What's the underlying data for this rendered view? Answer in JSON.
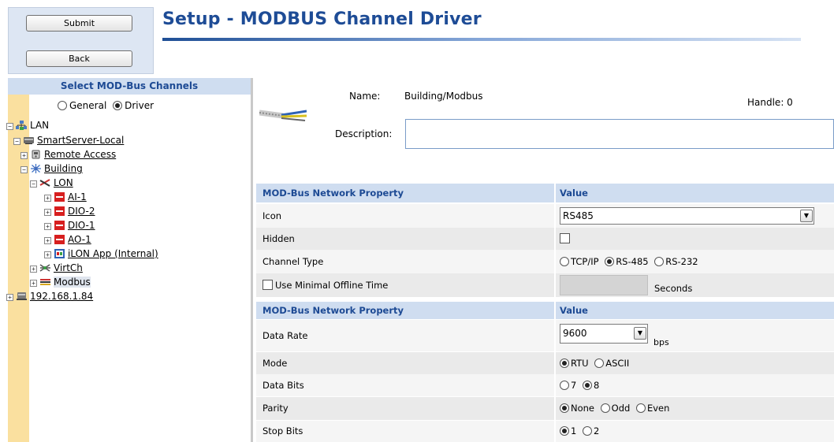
{
  "header": {
    "submit_label": "Submit",
    "back_label": "Back",
    "title": "Setup - MODBUS Channel Driver"
  },
  "tree": {
    "header": "Select MOD-Bus Channels",
    "view_options": [
      {
        "label": "General",
        "selected": false
      },
      {
        "label": "Driver",
        "selected": true
      }
    ],
    "nodes": [
      {
        "label": "LAN",
        "icon": "network-icon",
        "expander": "minus",
        "underline": false
      },
      {
        "label": "SmartServer-Local",
        "icon": "server-icon",
        "expander": "minus",
        "underline": true
      },
      {
        "label": "Remote Access",
        "icon": "phone-icon",
        "expander": "plus",
        "underline": true
      },
      {
        "label": "Building",
        "icon": "building-icon",
        "expander": "minus",
        "underline": true
      },
      {
        "label": "LON",
        "icon": "lon-channel-icon",
        "expander": "minus",
        "underline": true
      },
      {
        "label": "AI-1",
        "icon": "device-icon",
        "expander": "plus",
        "underline": true
      },
      {
        "label": "DIO-2",
        "icon": "device-icon",
        "expander": "plus",
        "underline": true
      },
      {
        "label": "DIO-1",
        "icon": "device-icon",
        "expander": "plus",
        "underline": true
      },
      {
        "label": "AO-1",
        "icon": "device-icon",
        "expander": "plus",
        "underline": true
      },
      {
        "label": "iLON App (Internal)",
        "icon": "app-icon",
        "expander": "plus",
        "underline": true
      },
      {
        "label": "VirtCh",
        "icon": "virtual-channel-icon",
        "expander": "plus",
        "underline": true
      },
      {
        "label": "Modbus",
        "icon": "modbus-icon",
        "expander": "plus",
        "underline": false,
        "selected": true
      },
      {
        "label": "192.168.1.84",
        "icon": "remote-server-icon",
        "expander": "plus",
        "underline": true
      }
    ]
  },
  "details": {
    "name_label": "Name:",
    "name_value": "Building/Modbus",
    "handle": "Handle: 0",
    "description_label": "Description:",
    "description_value": ""
  },
  "props": {
    "section1_header": "MOD-Bus Network Property",
    "value_header": "Value",
    "icon_label": "Icon",
    "icon_value": "RS485",
    "hidden_label": "Hidden",
    "channel_type_label": "Channel Type",
    "channel_types": [
      {
        "label": "TCP/IP",
        "selected": false
      },
      {
        "label": "RS-485",
        "selected": true
      },
      {
        "label": "RS-232",
        "selected": false
      }
    ],
    "min_offline_label": "Use Minimal Offline Time",
    "min_offline_unit": "Seconds",
    "section2_header": "MOD-Bus Network Property",
    "value_header2": "Value",
    "data_rate_label": "Data Rate",
    "data_rate_value": "9600",
    "data_rate_unit": "bps",
    "mode_label": "Mode",
    "modes": [
      {
        "label": "RTU",
        "selected": true
      },
      {
        "label": "ASCII",
        "selected": false
      }
    ],
    "data_bits_label": "Data Bits",
    "data_bits": [
      {
        "label": "7",
        "selected": false
      },
      {
        "label": "8",
        "selected": true
      }
    ],
    "parity_label": "Parity",
    "parity": [
      {
        "label": "None",
        "selected": true
      },
      {
        "label": "Odd",
        "selected": false
      },
      {
        "label": "Even",
        "selected": false
      }
    ],
    "stop_bits_label": "Stop Bits",
    "stop_bits": [
      {
        "label": "1",
        "selected": true
      },
      {
        "label": "2",
        "selected": false
      }
    ]
  }
}
